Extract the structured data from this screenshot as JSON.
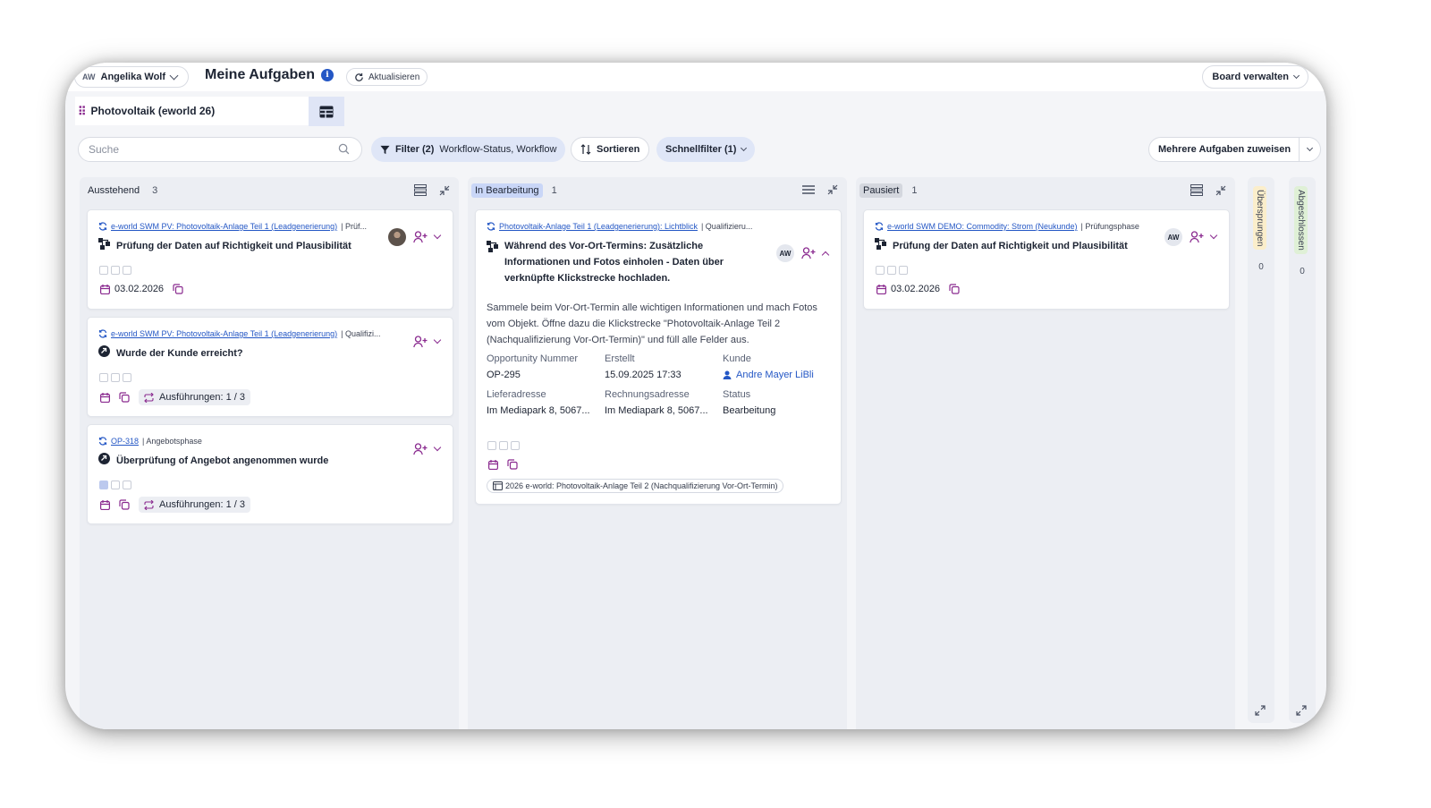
{
  "header": {
    "user_initials": "AW",
    "user_name": "Angelika Wolf",
    "page_title": "Meine Aufgaben",
    "refresh_label": "Aktualisieren",
    "board_manage_label": "Board verwalten"
  },
  "board": {
    "name": "Photovoltaik (eworld 26)"
  },
  "filters": {
    "search_placeholder": "Suche",
    "filter_label": "Filter (2)",
    "filter_detail": "Workflow-Status, Workflow",
    "sort_label": "Sortieren",
    "quick_filter_label": "Schnellfilter (1)",
    "assign_label": "Mehrere Aufgaben zuweisen"
  },
  "colors": {
    "accent_blue": "#2457c5",
    "brand_purple": "#8a2a8f",
    "status_in_progress": "#c9d6f7",
    "status_paused": "#d4d7de",
    "status_skipped": "#fbeecb",
    "status_done": "#dff0d6"
  },
  "columns": {
    "pending": {
      "title": "Ausstehend",
      "count": "3",
      "cards": [
        {
          "crumb_link": "e-world SWM PV: Photovoltaik-Anlage Teil 1 (Leadgenerierung)",
          "crumb_phase": "| Prüf...",
          "title": "Prüfung der Daten auf Richtigkeit und Plausibilität",
          "date": "03.02.2026"
        },
        {
          "crumb_link": "e-world SWM PV: Photovoltaik-Anlage Teil 1 (Leadgenerierung)",
          "crumb_phase": "| Qualifizi...",
          "title": "Wurde der Kunde erreicht?",
          "runs": "Ausführungen: 1 / 3"
        },
        {
          "crumb_link": "OP-318",
          "crumb_phase": "| Angebotsphase",
          "title": "Überprüfung of Angebot angenommen wurde",
          "runs": "Ausführungen: 1 / 3"
        }
      ]
    },
    "in_progress": {
      "title": "In Bearbeitung",
      "count": "1",
      "card": {
        "crumb_link": "Photovoltaik-Anlage Teil 1 (Leadgenerierung): Lichtblick",
        "crumb_phase": "| Qualifizieru...",
        "title": "Während des Vor-Ort-Termins: Zusätzliche Informationen und Fotos einholen - Daten über verknüpfte Klickstrecke hochladen.",
        "assignee": "AW",
        "description": "Sammele beim Vor-Ort-Termin alle wichtigen Informationen und mach Fotos vom Objekt. Öffne dazu die Klickstrecke \"Photovoltaik-Anlage Teil 2 (Nachqualifizierung Vor-Ort-Termin)\" und füll alle Felder aus.",
        "fields": {
          "opportunity_label": "Opportunity Nummer",
          "opportunity_value": "OP-295",
          "created_label": "Erstellt",
          "created_value": "15.09.2025 17:33",
          "customer_label": "Kunde",
          "customer_value": "Andre Mayer LiBli",
          "delivery_label": "Lieferadresse",
          "delivery_value": "Im Mediapark 8, 5067...",
          "billing_label": "Rechnungsadresse",
          "billing_value": "Im Mediapark 8, 5067...",
          "status_label": "Status",
          "status_value": "Bearbeitung"
        },
        "project": "2026 e-world: Photovoltaik-Anlage Teil 2 (Nachqualifizierung Vor-Ort-Termin)"
      }
    },
    "paused": {
      "title": "Pausiert",
      "count": "1",
      "card": {
        "crumb_link": "e-world SWM DEMO: Commodity: Strom (Neukunde)",
        "crumb_phase": "| Prüfungsphase",
        "title": "Prüfung der Daten auf Richtigkeit und Plausibilität",
        "assignee": "AW",
        "date": "03.02.2026"
      }
    },
    "skipped": {
      "title": "Übersprungen",
      "count": "0"
    },
    "done": {
      "title": "Abgeschlossen",
      "count": "0"
    }
  }
}
